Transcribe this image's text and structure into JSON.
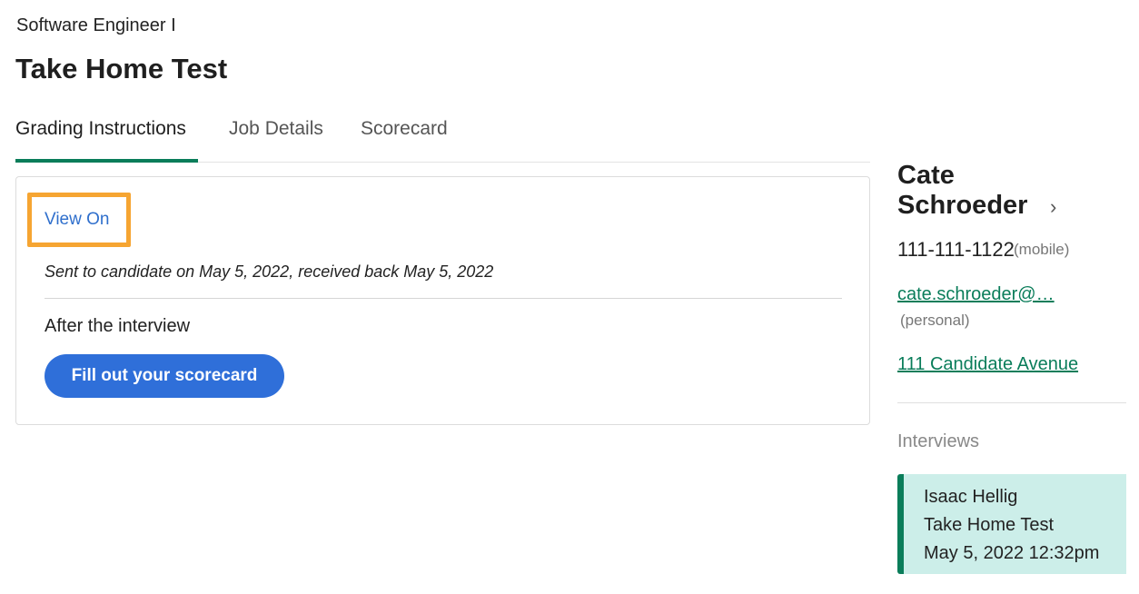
{
  "header": {
    "job_title": "Software Engineer I",
    "page_title": "Take Home Test"
  },
  "tabs": [
    {
      "label": "Grading Instructions",
      "active": true
    },
    {
      "label": "Job Details",
      "active": false
    },
    {
      "label": "Scorecard",
      "active": false
    }
  ],
  "card": {
    "view_link": "View On",
    "sent_text": "Sent to candidate on May 5, 2022, received back May 5, 2022",
    "after_text": "After the interview",
    "scorecard_button": "Fill out your scorecard"
  },
  "candidate": {
    "name_first": "Cate",
    "name_last": "Schroeder",
    "chevron": "›",
    "phone": "111-111-1122",
    "phone_type": "(mobile)",
    "email": "cate.schroeder@…",
    "email_type": "(personal)",
    "address": "111 Candidate Avenue"
  },
  "interviews": {
    "label": "Interviews",
    "items": [
      {
        "interviewer": "Isaac Hellig",
        "name": "Take Home Test",
        "datetime": "May 5, 2022 12:32pm"
      }
    ]
  },
  "colors": {
    "accent_green": "#0a7d5a",
    "link_blue": "#2f6fcc",
    "button_blue": "#2f6fd9",
    "highlight_orange": "#f6a532",
    "interview_card_bg": "#cceee9"
  }
}
